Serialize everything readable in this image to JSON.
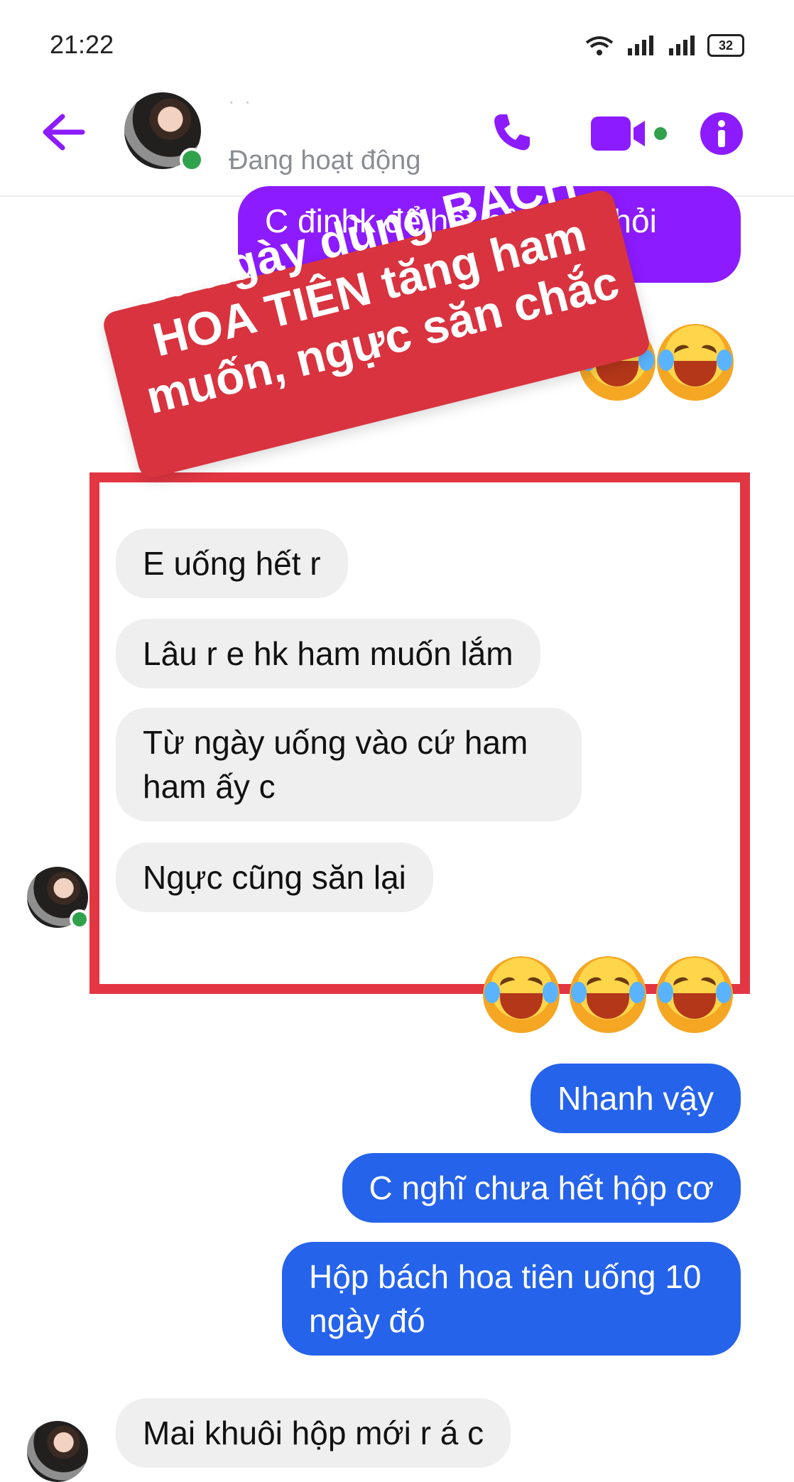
{
  "status_bar": {
    "time": "21:22",
    "battery": "32"
  },
  "header": {
    "contact_name": "· ·",
    "contact_status": "Đang hoạt động",
    "accent_color": "#8c1bff",
    "icons": [
      "back-arrow-icon",
      "phone-icon",
      "video-icon",
      "info-icon"
    ]
  },
  "banner": {
    "text": "10 ngày dùng BÁCH HOA TIÊN tăng ham muốn, ngực săn chắc"
  },
  "messages": {
    "top_outgoing": "C đinhk để hết hộp mới hỏi",
    "incoming": [
      "E uống hết r",
      "Lâu r e hk ham muốn lắm",
      "Từ ngày uống vào cứ ham ham ấy c",
      "Ngực cũng săn lại"
    ],
    "outgoing": [
      "Nhanh vậy",
      "C nghĩ chưa hết hộp cơ",
      "Hộp bách hoa tiên uống 10 ngày đó"
    ],
    "last_incoming": "Mai khuôi hộp mới r á c"
  },
  "colors": {
    "outgoing_bubble": "#2563eb",
    "incoming_bubble": "#efefef",
    "highlight": "#e23643",
    "online": "#31a24c"
  }
}
